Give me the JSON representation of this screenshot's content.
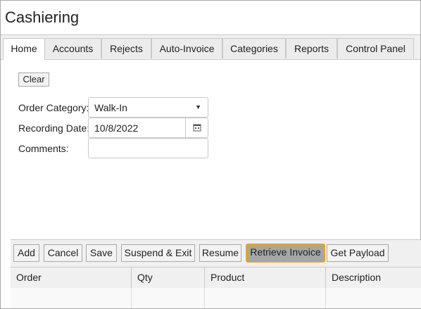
{
  "app": {
    "title": "Cashiering"
  },
  "tabs": [
    {
      "label": "Home",
      "active": true
    },
    {
      "label": "Accounts"
    },
    {
      "label": "Rejects"
    },
    {
      "label": "Auto-Invoice"
    },
    {
      "label": "Categories"
    },
    {
      "label": "Reports"
    },
    {
      "label": "Control Panel"
    }
  ],
  "form": {
    "clear_label": "Clear",
    "order_category_label": "Order Category:",
    "order_category_value": "Walk-In",
    "recording_date_label": "Recording Date:",
    "recording_date_value": "10/8/2022",
    "comments_label": "Comments:",
    "comments_value": ""
  },
  "toolbar": {
    "buttons": [
      {
        "label": "Add"
      },
      {
        "label": "Cancel"
      },
      {
        "label": "Save"
      },
      {
        "label": "Suspend & Exit"
      },
      {
        "label": "Resume"
      },
      {
        "label": "Retrieve Invoice",
        "highlighted": true
      },
      {
        "label": "Get Payload"
      }
    ]
  },
  "grid": {
    "columns": [
      "Order",
      "Qty",
      "Product",
      "Description"
    ],
    "rows": []
  },
  "colors": {
    "highlight_border": "#e8a51e",
    "highlight_bg": "#a6a6a6"
  },
  "icons": {
    "dropdown": "caret-down-icon",
    "calendar": "calendar-icon"
  }
}
